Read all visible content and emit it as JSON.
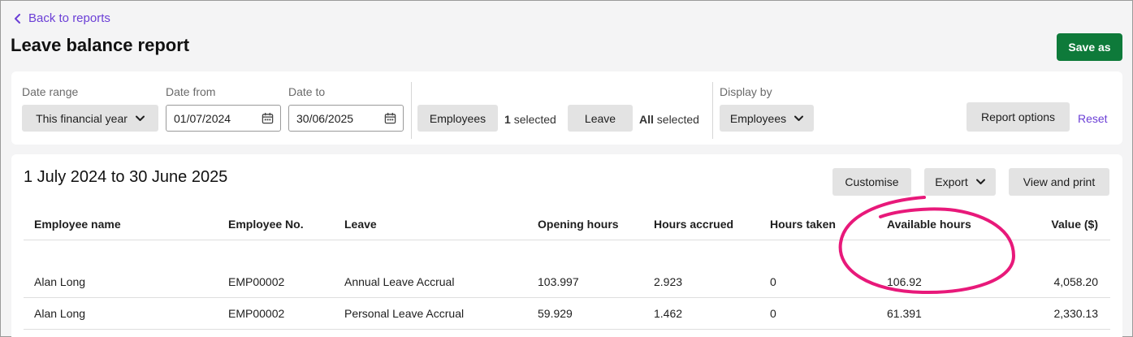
{
  "nav": {
    "back_label": "Back to reports"
  },
  "page": {
    "title": "Leave balance report",
    "save_label": "Save as"
  },
  "filters": {
    "date_range": {
      "label": "Date range",
      "value": "This financial year"
    },
    "date_from": {
      "label": "Date from",
      "value": "01/07/2024"
    },
    "date_to": {
      "label": "Date to",
      "value": "30/06/2025"
    },
    "employees": {
      "button": "Employees",
      "count": "1",
      "suffix": "selected"
    },
    "leave": {
      "button": "Leave",
      "count": "All",
      "suffix": "selected"
    },
    "display_by": {
      "label": "Display by",
      "value": "Employees"
    },
    "report_options_label": "Report options",
    "reset_label": "Reset"
  },
  "report": {
    "period": "1 July 2024 to 30 June 2025",
    "customise_label": "Customise",
    "export_label": "Export",
    "view_print_label": "View and print",
    "columns": [
      "Employee name",
      "Employee No.",
      "Leave",
      "Opening hours",
      "Hours accrued",
      "Hours taken",
      "Available hours",
      "Value ($)"
    ],
    "rows": [
      [
        "Alan Long",
        "EMP00002",
        "Annual Leave Accrual",
        "103.997",
        "2.923",
        "0",
        "106.92",
        "4,058.20"
      ],
      [
        "Alan Long",
        "EMP00002",
        "Personal Leave Accrual",
        "59.929",
        "1.462",
        "0",
        "61.391",
        "2,330.13"
      ]
    ]
  },
  "colors": {
    "accent": "#6b3fd6",
    "save": "#0e7a3a",
    "highlight": "#e8197a"
  }
}
